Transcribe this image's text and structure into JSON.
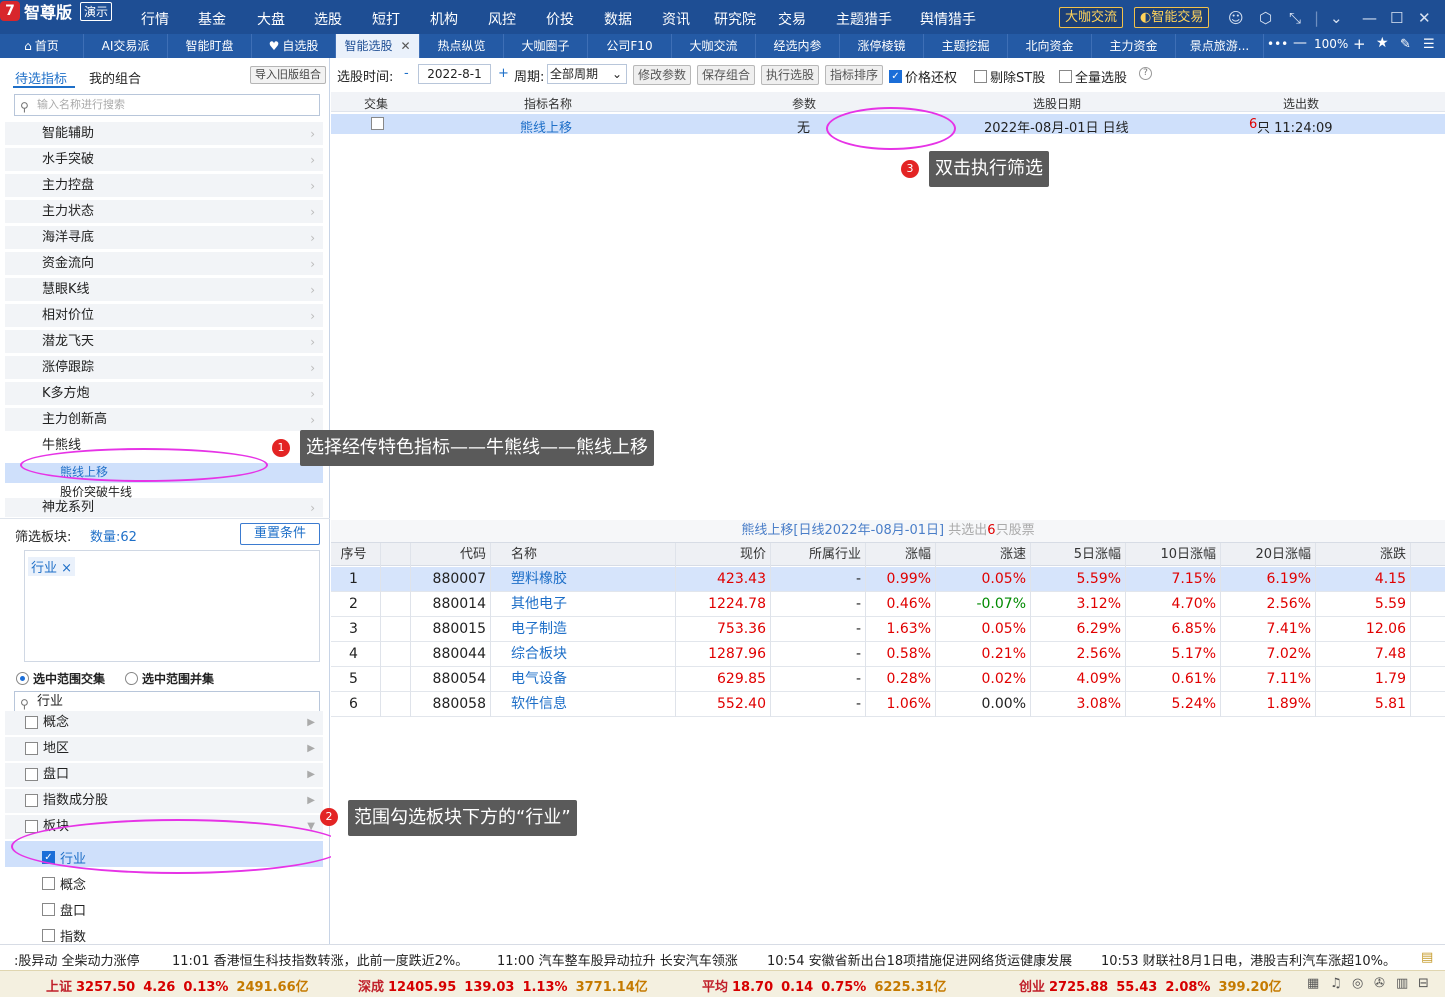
{
  "app": {
    "brand": "智尊版",
    "demo": "演示"
  },
  "menu": [
    {
      "label": "行情",
      "dot": true
    },
    {
      "label": "基金",
      "dot": false
    },
    {
      "label": "大盘",
      "dot": true
    },
    {
      "label": "选股",
      "dot": true
    },
    {
      "label": "短打",
      "dot": false
    },
    {
      "label": "机构",
      "dot": true
    },
    {
      "label": "风控",
      "dot": false
    },
    {
      "label": "价投",
      "dot": false
    },
    {
      "label": "数据",
      "dot": false
    },
    {
      "label": "资讯",
      "dot": false
    },
    {
      "label": "研究院",
      "dot": false
    },
    {
      "label": "交易",
      "dot": false
    },
    {
      "label": "主题猎手",
      "dot": false
    },
    {
      "label": "舆情猎手",
      "dot": false
    }
  ],
  "header_buttons": {
    "daka": "大咖交流",
    "smart_trade": "智能交易"
  },
  "tabs": [
    "首页",
    "AI交易派",
    "智能盯盘",
    "自选股",
    "智能选股",
    "热点纵览",
    "大咖圈子",
    "公司F10",
    "大咖交流",
    "经选内参",
    "涨停棱镜",
    "主题挖掘",
    "北向资金",
    "主力资金",
    "景点旅游..."
  ],
  "active_tab": "智能选股",
  "zoom": "100%",
  "left": {
    "tabs": {
      "pending": "待选指标",
      "mine": "我的组合"
    },
    "import_btn": "导入旧版组合",
    "search_placeholder": "输入名称进行搜索",
    "indicators": [
      "智能辅助",
      "水手突破",
      "主力控盘",
      "主力状态",
      "海洋寻底",
      "资金流向",
      "慧眼K线",
      "相对价位",
      "潜龙飞天",
      "涨停跟踪",
      "K多方炮",
      "主力创新高",
      "牛熊线"
    ],
    "sub_items": [
      "熊线上移",
      "股价突破牛线"
    ],
    "next_group": "神龙系列",
    "filter_label": "筛选板块:",
    "count_label": "数量:62",
    "reset_btn": "重置条件",
    "tag": "行业 ×",
    "radio_intersect": "选中范围交集",
    "radio_union": "选中范围并集",
    "search2": "行业",
    "parent_items": [
      "概念",
      "地区",
      "盘口",
      "指数成分股",
      "板块"
    ],
    "board_items": [
      "行业",
      "概念",
      "盘口",
      "指数"
    ]
  },
  "toolbar": {
    "time_label": "选股时间:",
    "minus": "-",
    "date": "2022-8-1",
    "plus": "+",
    "period_label": "周期:",
    "period": "全部周期",
    "btn_modify": "修改参数",
    "btn_save": "保存组合",
    "btn_exec": "执行选股",
    "btn_sort": "指标排序",
    "chk_restore": "价格还权",
    "chk_st": "剔除ST股",
    "chk_all": "全量选股",
    "help": "?"
  },
  "upper_table": {
    "headers": [
      "交集",
      "指标名称",
      "参数",
      "选股日期",
      "选出数"
    ],
    "row": {
      "name": "熊线上移",
      "param": "无",
      "date": "2022年-08月-01日 日线",
      "count": "6",
      "count_suffix": "只 11:24:09"
    }
  },
  "annotations": [
    {
      "n": "1",
      "text": "选择经传特色指标——牛熊线——熊线上移"
    },
    {
      "n": "2",
      "text": "范围勾选板块下方的“行业”"
    },
    {
      "n": "3",
      "text": "双击执行筛选"
    }
  ],
  "result": {
    "title_a": "熊线上移[日线2022年-08月-01日]",
    "title_b": "共选出",
    "title_n": "6",
    "title_c": "只股票",
    "headers": [
      "序号",
      "代码",
      "名称",
      "现价",
      "所属行业",
      "涨幅",
      "涨速",
      "5日涨幅",
      "10日涨幅",
      "20日涨幅",
      "涨跌"
    ],
    "rows": [
      [
        "1",
        "880007",
        "塑料橡胶",
        "423.43",
        "-",
        "0.99%",
        "0.05%",
        "5.59%",
        "7.15%",
        "6.19%",
        "4.15"
      ],
      [
        "2",
        "880014",
        "其他电子",
        "1224.78",
        "-",
        "0.46%",
        "-0.07%",
        "3.12%",
        "4.70%",
        "2.56%",
        "5.59"
      ],
      [
        "3",
        "880015",
        "电子制造",
        "753.36",
        "-",
        "1.63%",
        "0.05%",
        "6.29%",
        "6.85%",
        "7.41%",
        "12.06"
      ],
      [
        "4",
        "880044",
        "综合板块",
        "1287.96",
        "-",
        "0.58%",
        "0.21%",
        "2.56%",
        "5.17%",
        "7.02%",
        "7.48"
      ],
      [
        "5",
        "880054",
        "电气设备",
        "629.85",
        "-",
        "0.28%",
        "0.02%",
        "4.09%",
        "0.61%",
        "7.11%",
        "1.79"
      ],
      [
        "6",
        "880058",
        "软件信息",
        "552.40",
        "-",
        "1.06%",
        "0.00%",
        "3.08%",
        "5.24%",
        "1.89%",
        "5.81"
      ]
    ]
  },
  "news": [
    ":股异动 全柴动力涨停",
    "11:01 香港恒生科技指数转涨，此前一度跌近2%。",
    "11:00 汽车整车股异动拉升 长安汽车领涨",
    "10:54 安徽省新出台18项措施促进网络货运健康发展",
    "10:53 财联社8月1日电，港股吉利汽车涨超10%。"
  ],
  "indices": [
    {
      "name": "上证",
      "value": "3257.50",
      "chg": "4.26",
      "pct": "0.13%",
      "amt": "2491.66亿"
    },
    {
      "name": "深成",
      "value": "12405.95",
      "chg": "139.03",
      "pct": "1.13%",
      "amt": "3771.14亿"
    },
    {
      "name": "平均",
      "value": "18.70",
      "chg": "0.14",
      "pct": "0.75%",
      "amt": "6225.31亿"
    },
    {
      "name": "创业",
      "value": "2725.88",
      "chg": "55.43",
      "pct": "2.08%",
      "amt": "399.20亿"
    }
  ]
}
